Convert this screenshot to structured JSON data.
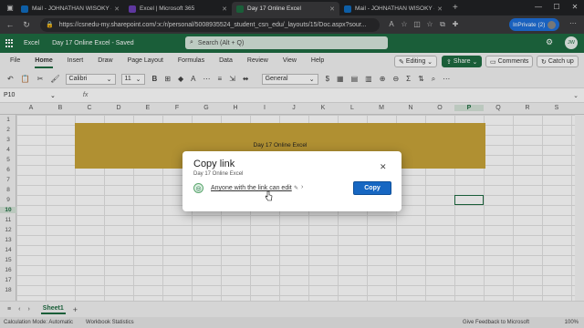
{
  "browser": {
    "tabs": [
      {
        "title": "Mail - JOHNATHAN WISOKY - O",
        "color": "#0f6cbd",
        "active": false
      },
      {
        "title": "Excel | Microsoft 365",
        "color": "#6b3fb5",
        "active": false
      },
      {
        "title": "Day 17 Online Excel",
        "color": "#1e6c41",
        "active": true
      },
      {
        "title": "Mail - JOHNATHAN WISOKY - O",
        "color": "#0f6cbd",
        "active": false
      }
    ],
    "url": "https://csnedu-my.sharepoint.com/:x:/r/personal/5008935524_student_csn_edu/_layouts/15/Doc.aspx?sour...",
    "inprivate_label": "InPrivate (2)"
  },
  "excel": {
    "app_name": "Excel",
    "doc_title": "Day 17 Online Excel  -  Saved",
    "search_placeholder": "Search (Alt + Q)",
    "user_initials": "JW",
    "ribbon_tabs": [
      "File",
      "Home",
      "Insert",
      "Draw",
      "Page Layout",
      "Formulas",
      "Data",
      "Review",
      "View",
      "Help"
    ],
    "active_tab": "Home",
    "editing_label": "Editing",
    "share_label": "Share",
    "comments_label": "Comments",
    "catchup_label": "Catch up",
    "font_name": "Calibri",
    "font_size": "11",
    "number_format": "General",
    "name_box": "P10",
    "fx_label": "fx",
    "columns": [
      "A",
      "B",
      "C",
      "D",
      "E",
      "F",
      "G",
      "H",
      "I",
      "J",
      "K",
      "L",
      "M",
      "N",
      "O",
      "P",
      "Q",
      "R",
      "S"
    ],
    "rows": [
      "1",
      "2",
      "3",
      "4",
      "5",
      "6",
      "7",
      "8",
      "9",
      "10",
      "11",
      "12",
      "13",
      "14",
      "15",
      "16",
      "17",
      "18"
    ],
    "banner_text": "Day 17 Online Excel",
    "sheet_tab": "Sheet1",
    "status_calc": "Calculation Mode: Automatic",
    "status_stats": "Workbook Statistics",
    "status_feedback": "Give Feedback to Microsoft",
    "status_zoom": "100%"
  },
  "dialog": {
    "title": "Copy link",
    "subtitle": "Day 17 Online Excel",
    "permission": "Anyone with the link can edit",
    "copy_label": "Copy"
  }
}
